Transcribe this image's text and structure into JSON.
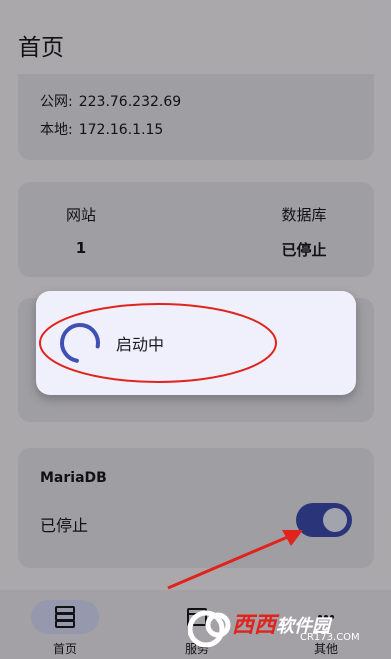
{
  "header": {
    "title": "首页"
  },
  "ip_card": {
    "public_label": "公网:",
    "public_value": "223.76.232.69",
    "local_label": "本地:",
    "local_value": "172.16.1.15"
  },
  "stats_card": {
    "site_label": "网站",
    "site_value": "1",
    "db_label": "数据库",
    "db_value": "已停止"
  },
  "maria_card": {
    "name": "MariaDB",
    "status": "已停止",
    "switch_on": true
  },
  "dialog": {
    "text": "启动中"
  },
  "bottom_nav": {
    "items": [
      {
        "label": "首页",
        "icon": "server-icon",
        "active": true
      },
      {
        "label": "服务",
        "icon": "service-icon",
        "active": false
      },
      {
        "label": "其他",
        "icon": "other-icon",
        "active": false
      }
    ]
  },
  "watermark": {
    "brand": "西西",
    "suffix": "软件园",
    "site": "CR173.COM"
  },
  "colors": {
    "accent": "#3f4fb3",
    "annotation_red": "#e0231c",
    "card_bg": "#ebe9f0"
  }
}
